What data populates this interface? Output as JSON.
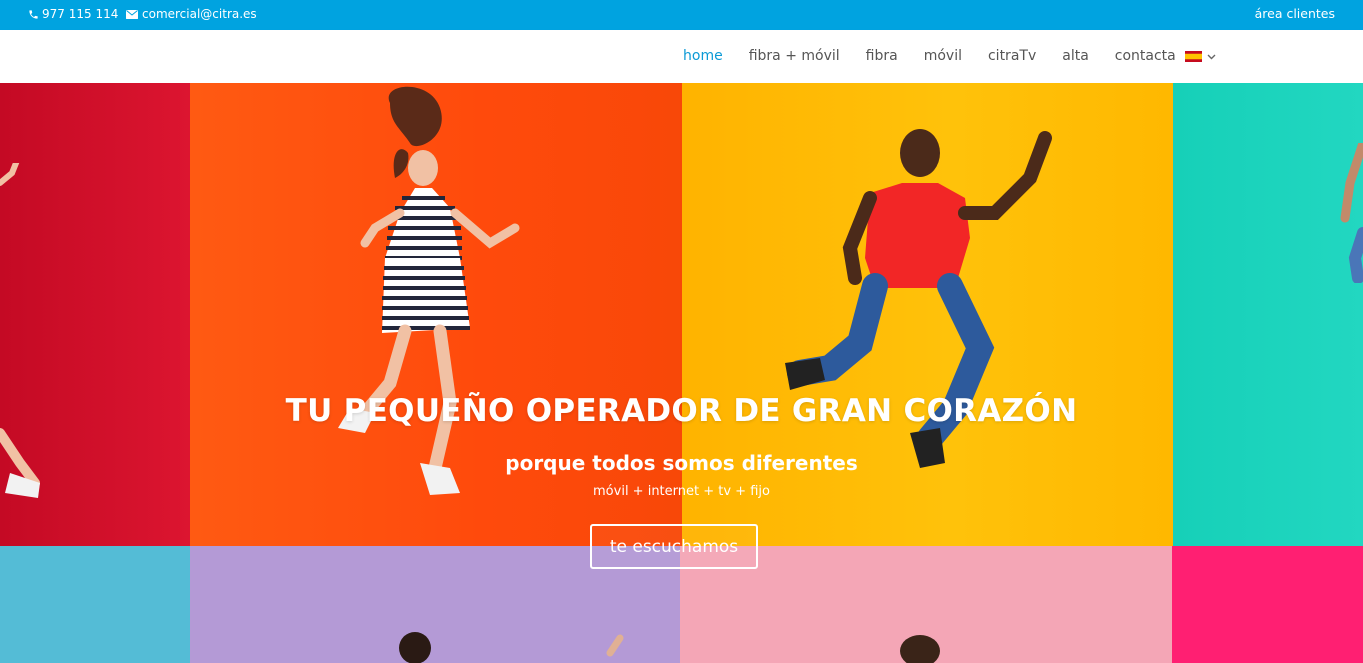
{
  "topbar": {
    "phone": "977 115 114",
    "email": "comercial@citra.es",
    "client_area": "área clientes",
    "background": "#00a3e0"
  },
  "nav": {
    "items": [
      {
        "label": "home",
        "active": true
      },
      {
        "label": "fibra + móvil",
        "active": false
      },
      {
        "label": "fibra",
        "active": false
      },
      {
        "label": "móvil",
        "active": false
      },
      {
        "label": "citraTv",
        "active": false
      },
      {
        "label": "alta",
        "active": false
      },
      {
        "label": "contacta",
        "active": false
      }
    ],
    "language_icon": "spain-flag-icon",
    "active_color": "#0c9ad6"
  },
  "hero": {
    "headline": "TU PEQUEÑO OPERADOR DE GRAN CORAZÓN",
    "subheadline": "porque todos somos diferentes",
    "tagline": "móvil + internet + tv + fijo",
    "cta_label": "te escuchamos",
    "panel_colors": [
      "#d6112c",
      "#ff4f0f",
      "#ffbf00",
      "#19d3bc",
      "#4fbcd9",
      "#b59bd8",
      "#f5a7b8",
      "#ff1d73"
    ]
  }
}
